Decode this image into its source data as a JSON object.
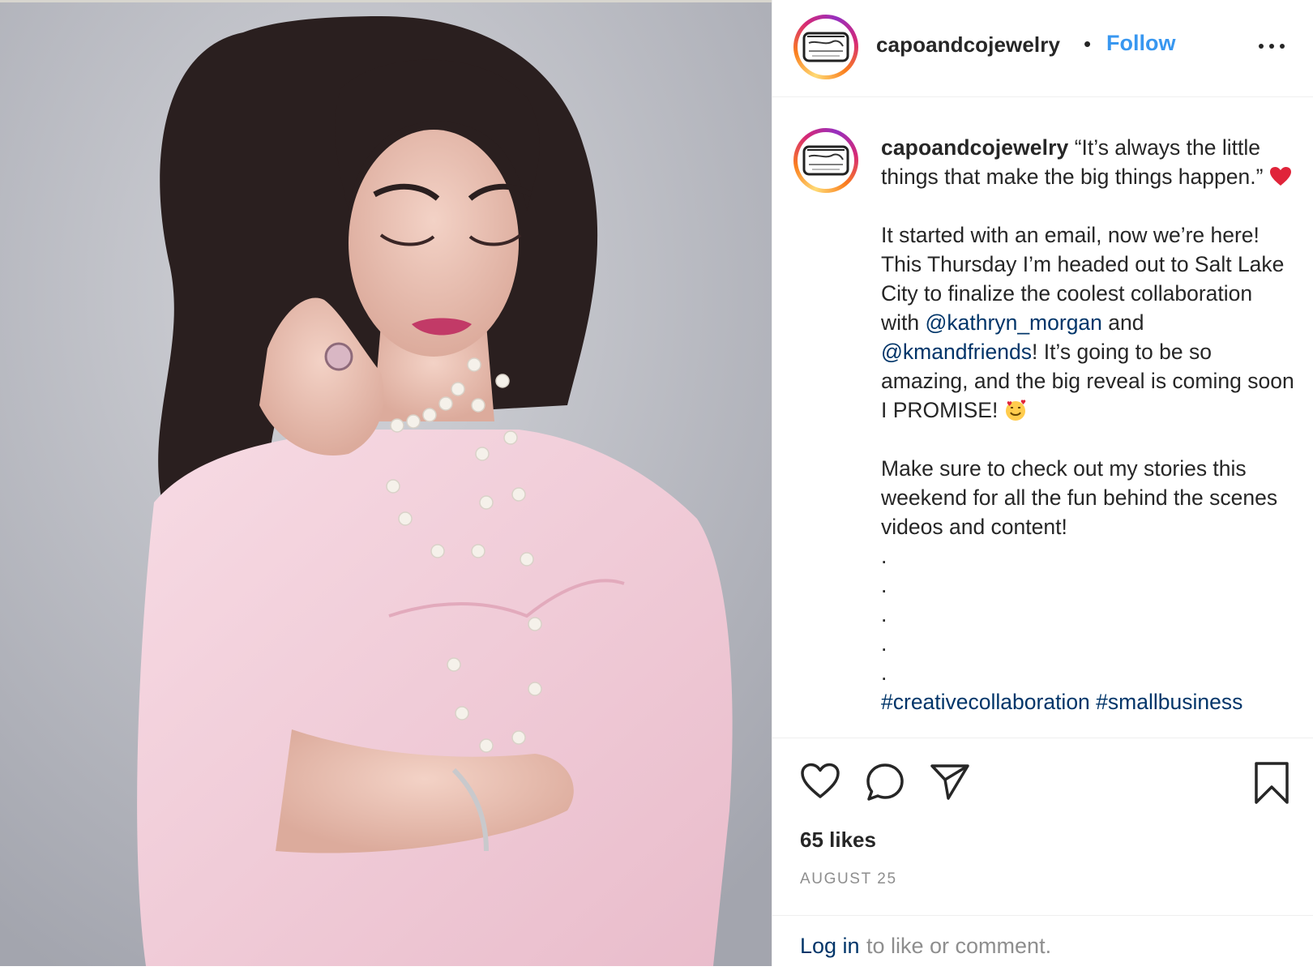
{
  "post": {
    "username": "capoandcojewelry",
    "header": {
      "separator": "•",
      "follow_label": "Follow",
      "more_icon": "more-options-icon"
    },
    "photo": {
      "subject": "woman-in-pink-with-pearl-necklace"
    },
    "caption": {
      "username": "capoandcojewelry",
      "quote": "“It’s always the little things that make the big things happen.”",
      "para2_part1": "It started with an email, now we’re here! This Thursday I’m headed out to Salt Lake City to finalize the coolest collaboration with",
      "mention1": "@kathryn_morgan",
      "para2_part2": "and",
      "mention2": "@kmandfriends",
      "para2_part3": "! It’s going to be so amazing, and the big reveal is coming soon I PROMISE!",
      "para3": "Make sure to check out my stories this weekend for all the fun behind the scenes videos and content!",
      "dots": [
        ".",
        ".",
        ".",
        ".",
        "."
      ],
      "hashtags": "#creativecollaboration #smallbusiness"
    },
    "actions": {
      "like_icon": "heart-icon",
      "comment_icon": "comment-icon",
      "share_icon": "share-icon",
      "save_icon": "bookmark-icon"
    },
    "likes": "65 likes",
    "date": "AUGUST 25",
    "login": {
      "link": "Log in",
      "rest": "to like or comment."
    }
  },
  "colors": {
    "link_blue": "#3897f0",
    "mention_blue": "#003569",
    "muted": "#8e8e8e",
    "text": "#262626"
  }
}
